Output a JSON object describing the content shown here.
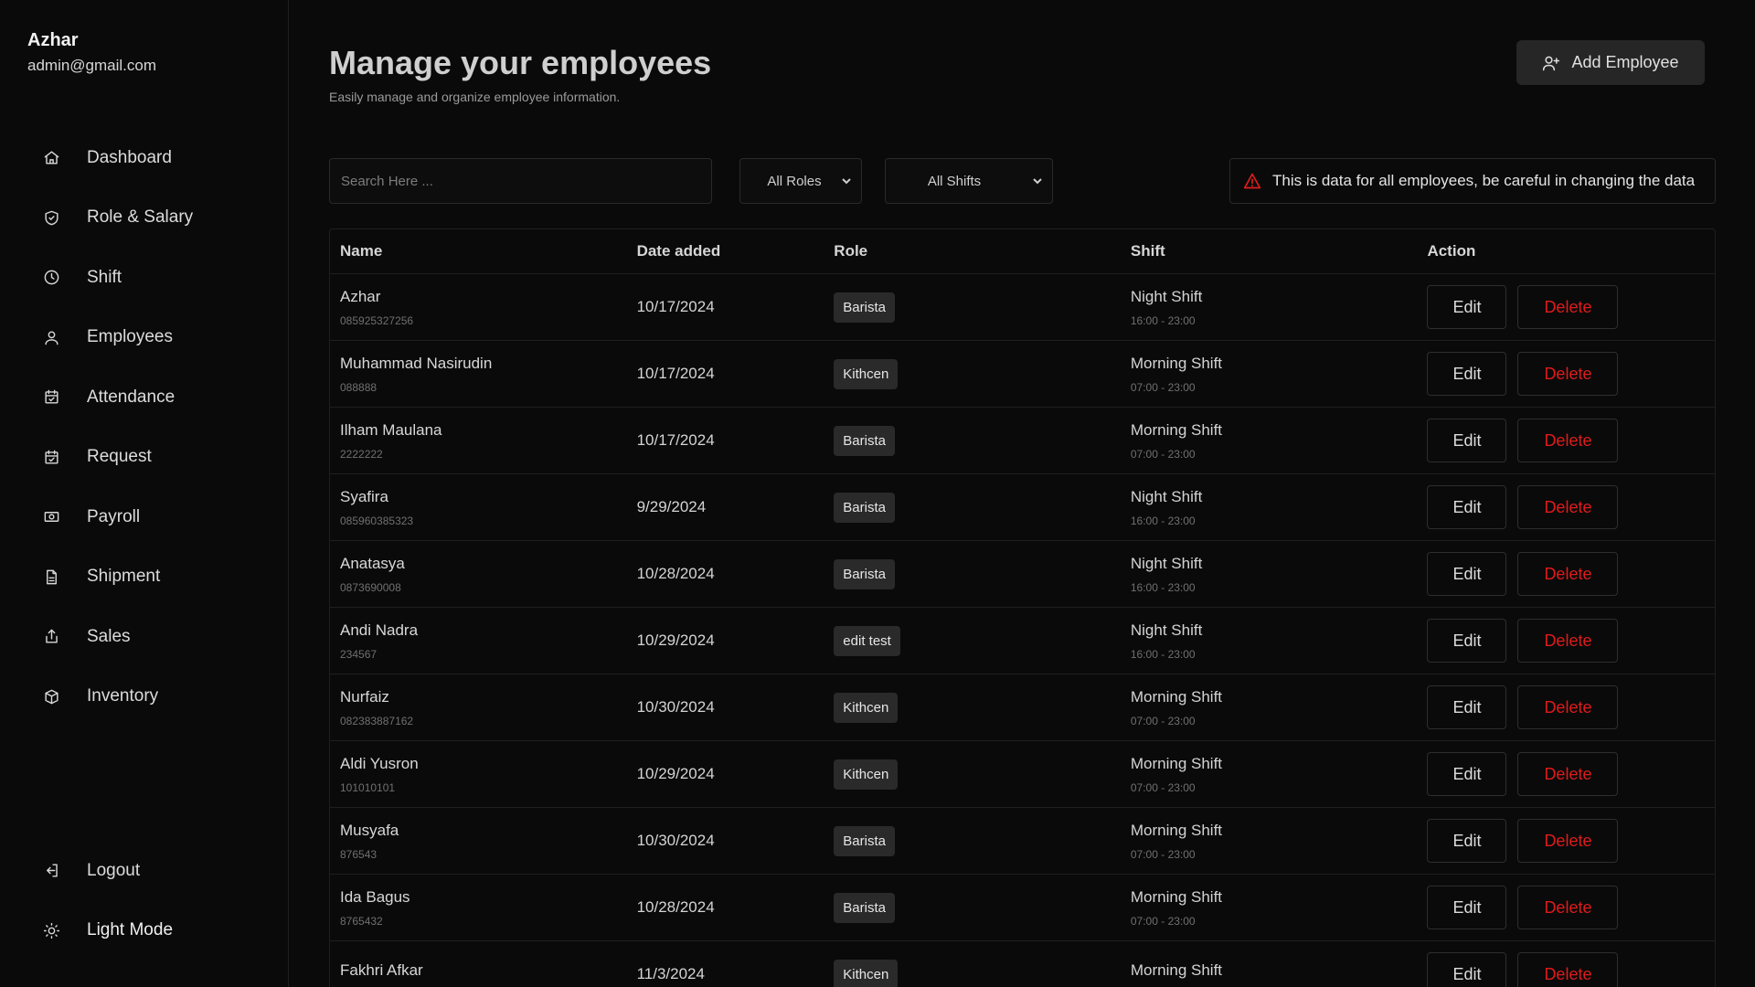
{
  "user": {
    "name": "Azhar",
    "email": "admin@gmail.com"
  },
  "sidebar": {
    "items": [
      {
        "label": "Dashboard",
        "icon": "home-icon"
      },
      {
        "label": "Role & Salary",
        "icon": "shield-icon"
      },
      {
        "label": "Shift",
        "icon": "clock-icon"
      },
      {
        "label": "Employees",
        "icon": "user-icon"
      },
      {
        "label": "Attendance",
        "icon": "calendar-check-icon"
      },
      {
        "label": "Request",
        "icon": "calendar-check-icon"
      },
      {
        "label": "Payroll",
        "icon": "cash-icon"
      },
      {
        "label": "Shipment",
        "icon": "file-icon"
      },
      {
        "label": "Sales",
        "icon": "share-icon"
      },
      {
        "label": "Inventory",
        "icon": "box-icon"
      }
    ],
    "logout": "Logout",
    "light_mode": "Light Mode"
  },
  "header": {
    "title": "Manage your employees",
    "subtitle": "Easily manage and organize employee information.",
    "add_button": "Add Employee"
  },
  "filters": {
    "search_placeholder": "Search Here ...",
    "roles": "All Roles",
    "shifts": "All Shifts",
    "warning": "This is data for all employees, be careful in changing the data"
  },
  "table": {
    "headers": {
      "name": "Name",
      "date": "Date added",
      "role": "Role",
      "shift": "Shift",
      "action": "Action"
    },
    "edit_label": "Edit",
    "delete_label": "Delete",
    "rows": [
      {
        "name": "Azhar",
        "phone": "085925327256",
        "date": "10/17/2024",
        "role": "Barista",
        "shift": "Night Shift",
        "time": "16:00 - 23:00"
      },
      {
        "name": "Muhammad Nasirudin",
        "phone": "088888",
        "date": "10/17/2024",
        "role": "Kithcen",
        "shift": "Morning Shift",
        "time": "07:00 - 23:00"
      },
      {
        "name": "Ilham Maulana",
        "phone": "2222222",
        "date": "10/17/2024",
        "role": "Barista",
        "shift": "Morning Shift",
        "time": "07:00 - 23:00"
      },
      {
        "name": "Syafira",
        "phone": "085960385323",
        "date": "9/29/2024",
        "role": "Barista",
        "shift": "Night Shift",
        "time": "16:00 - 23:00"
      },
      {
        "name": "Anatasya",
        "phone": "0873690008",
        "date": "10/28/2024",
        "role": "Barista",
        "shift": "Night Shift",
        "time": "16:00 - 23:00"
      },
      {
        "name": "Andi Nadra",
        "phone": "234567",
        "date": "10/29/2024",
        "role": "edit test",
        "shift": "Night Shift",
        "time": "16:00 - 23:00"
      },
      {
        "name": "Nurfaiz",
        "phone": "082383887162",
        "date": "10/30/2024",
        "role": "Kithcen",
        "shift": "Morning Shift",
        "time": "07:00 - 23:00"
      },
      {
        "name": "Aldi Yusron",
        "phone": "101010101",
        "date": "10/29/2024",
        "role": "Kithcen",
        "shift": "Morning Shift",
        "time": "07:00 - 23:00"
      },
      {
        "name": "Musyafa",
        "phone": "876543",
        "date": "10/30/2024",
        "role": "Barista",
        "shift": "Morning Shift",
        "time": "07:00 - 23:00"
      },
      {
        "name": "Ida Bagus",
        "phone": "8765432",
        "date": "10/28/2024",
        "role": "Barista",
        "shift": "Morning Shift",
        "time": "07:00 - 23:00"
      },
      {
        "name": "Fakhri Afkar",
        "phone": "",
        "date": "11/3/2024",
        "role": "Kithcen",
        "shift": "Morning Shift",
        "time": ""
      }
    ]
  },
  "colors": {
    "background": "#0a0a0a",
    "danger": "#e01b1b",
    "badge": "#2a2a2a",
    "border": "#1f1f1f"
  }
}
